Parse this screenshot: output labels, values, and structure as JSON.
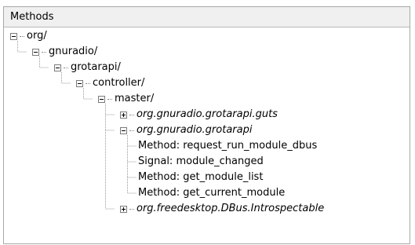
{
  "panel": {
    "header": "Methods"
  },
  "tree": {
    "nodes": [
      {
        "label": "org/",
        "state": "expanded"
      },
      {
        "label": "gnuradio/",
        "state": "expanded"
      },
      {
        "label": "grotarapi/",
        "state": "expanded"
      },
      {
        "label": "controller/",
        "state": "expanded"
      },
      {
        "label": "master/",
        "state": "expanded"
      },
      {
        "label": "org.gnuradio.grotarapi.guts",
        "state": "collapsed",
        "kind": "interface"
      },
      {
        "label": "org.gnuradio.grotarapi",
        "state": "expanded",
        "kind": "interface"
      },
      {
        "label": "Method: request_run_module_dbus",
        "kind": "member"
      },
      {
        "label": "Signal: module_changed",
        "kind": "member"
      },
      {
        "label": "Method: get_module_list",
        "kind": "member"
      },
      {
        "label": "Method: get_current_module",
        "kind": "member"
      },
      {
        "label": "org.freedesktop.DBus.Introspectable",
        "state": "collapsed",
        "kind": "interface"
      }
    ]
  }
}
